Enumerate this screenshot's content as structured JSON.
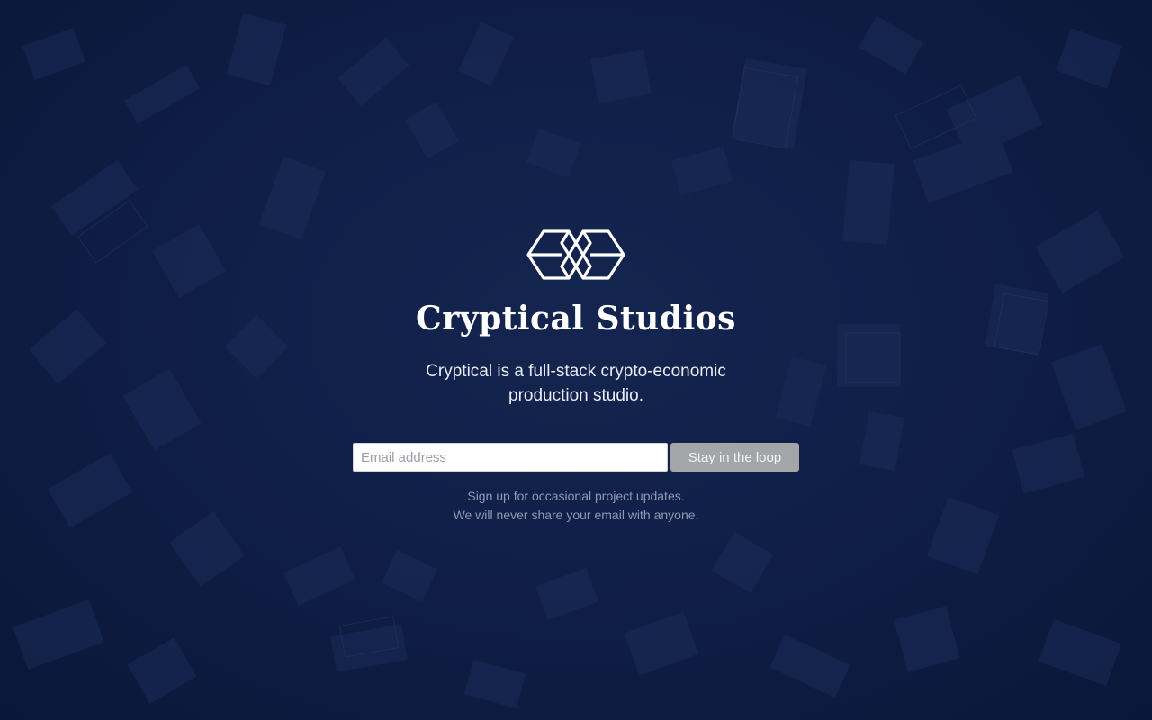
{
  "brand": {
    "logo_icon": "interlocking-cubes-icon",
    "title": "Cryptical Studios",
    "tagline": "Cryptical is a full-stack crypto-economic production studio."
  },
  "signup": {
    "email_placeholder": "Email address",
    "email_value": "",
    "button_label": "Stay in the loop"
  },
  "note": {
    "line1": "Sign up for occasional project updates.",
    "line2": "We will never share your email with anyone."
  },
  "colors": {
    "background": "#0f1d45",
    "button": "#a4a5a9",
    "text": "#ffffff",
    "note": "#8f99b2"
  }
}
